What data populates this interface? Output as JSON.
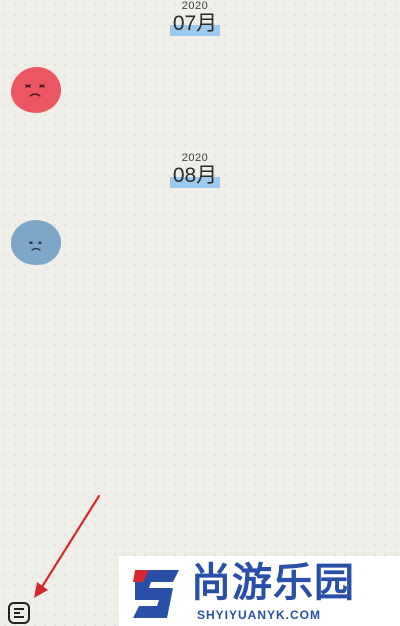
{
  "timeline": [
    {
      "year": "2020",
      "month": "07月",
      "mood": "sad-red"
    },
    {
      "year": "2020",
      "month": "08月",
      "mood": "sad-blue"
    }
  ],
  "icons": {
    "red_mood": "sad-face-icon",
    "blue_mood": "sad-face-icon",
    "menu": "list-menu-icon",
    "annotation": "red-arrow"
  },
  "colors": {
    "red_mood": "#ec5663",
    "blue_mood": "#7ea6c9",
    "month_highlight": "#9ec9ec",
    "arrow": "#d7282f",
    "brand": "#2a4fa6"
  },
  "watermark": {
    "name": "尚游乐园",
    "url": "SHYIYUANYK.COM"
  }
}
